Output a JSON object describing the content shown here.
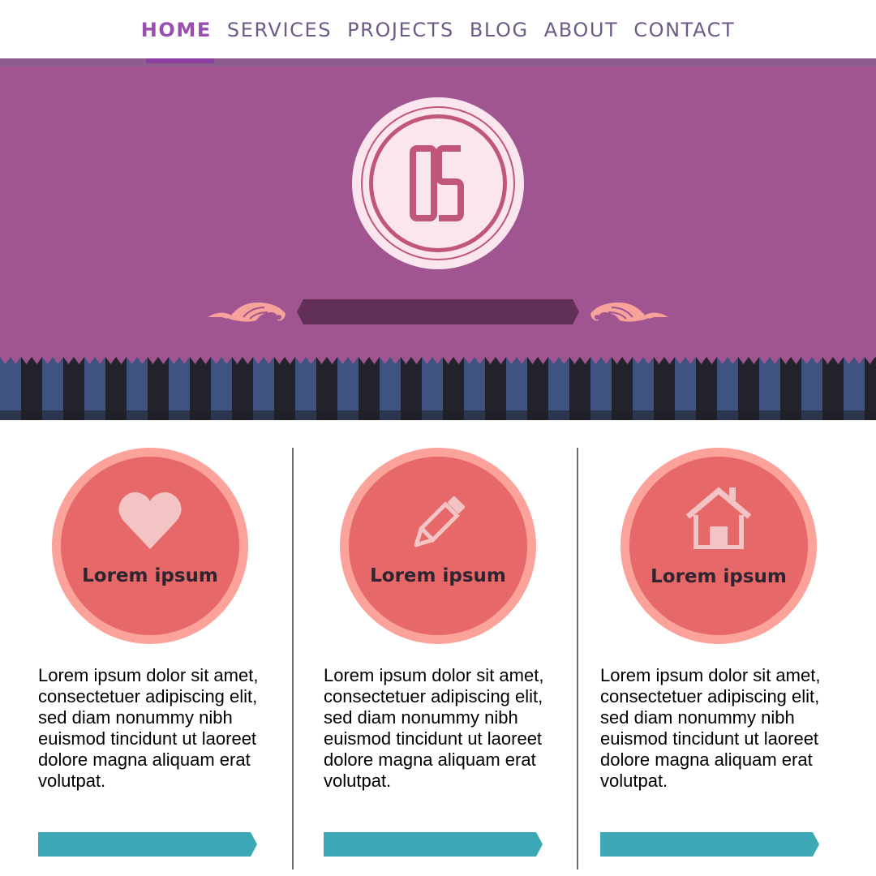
{
  "nav": {
    "items": [
      {
        "label": "HOME",
        "active": true
      },
      {
        "label": "SERVICES",
        "active": false
      },
      {
        "label": "PROJECTS",
        "active": false
      },
      {
        "label": "BLOG",
        "active": false
      },
      {
        "label": "ABOUT",
        "active": false
      },
      {
        "label": "CONTACT",
        "active": false
      }
    ]
  },
  "hero": {
    "logo_text": "OS"
  },
  "features": [
    {
      "icon": "heart-icon",
      "title": "Lorem ipsum",
      "text": "Lorem ipsum dolor sit amet, consectetuer adipiscing elit, sed diam nonummy nibh euismod tincidunt ut laoreet dolore magna aliquam erat volutpat."
    },
    {
      "icon": "pencil-icon",
      "title": "Lorem ipsum",
      "text": "Lorem ipsum dolor sit amet, consectetuer adipiscing elit, sed diam nonummy nibh euismod tincidunt ut laoreet dolore magna aliquam erat volutpat."
    },
    {
      "icon": "house-icon",
      "title": "Lorem ipsum",
      "text": "Lorem ipsum dolor sit amet, consectetuer adipiscing elit, sed diam nonummy nibh euismod tincidunt ut laoreet dolore magna aliquam erat volutpat."
    }
  ],
  "colors": {
    "hero_bg": "#a15590",
    "nav_active": "#9b4fb1",
    "nav_text": "#6d5a86",
    "logo_fill": "#fbe5ee",
    "logo_accent": "#c0567a",
    "banner": "#612f58",
    "flourish": "#f7a29a",
    "stripe_blue": "#3e5380",
    "stripe_dark": "#22232c",
    "circle_outer": "#fba39b",
    "circle_inner": "#e76868",
    "icon_fill": "#f3c4c4",
    "cta": "#3ea9b6"
  }
}
